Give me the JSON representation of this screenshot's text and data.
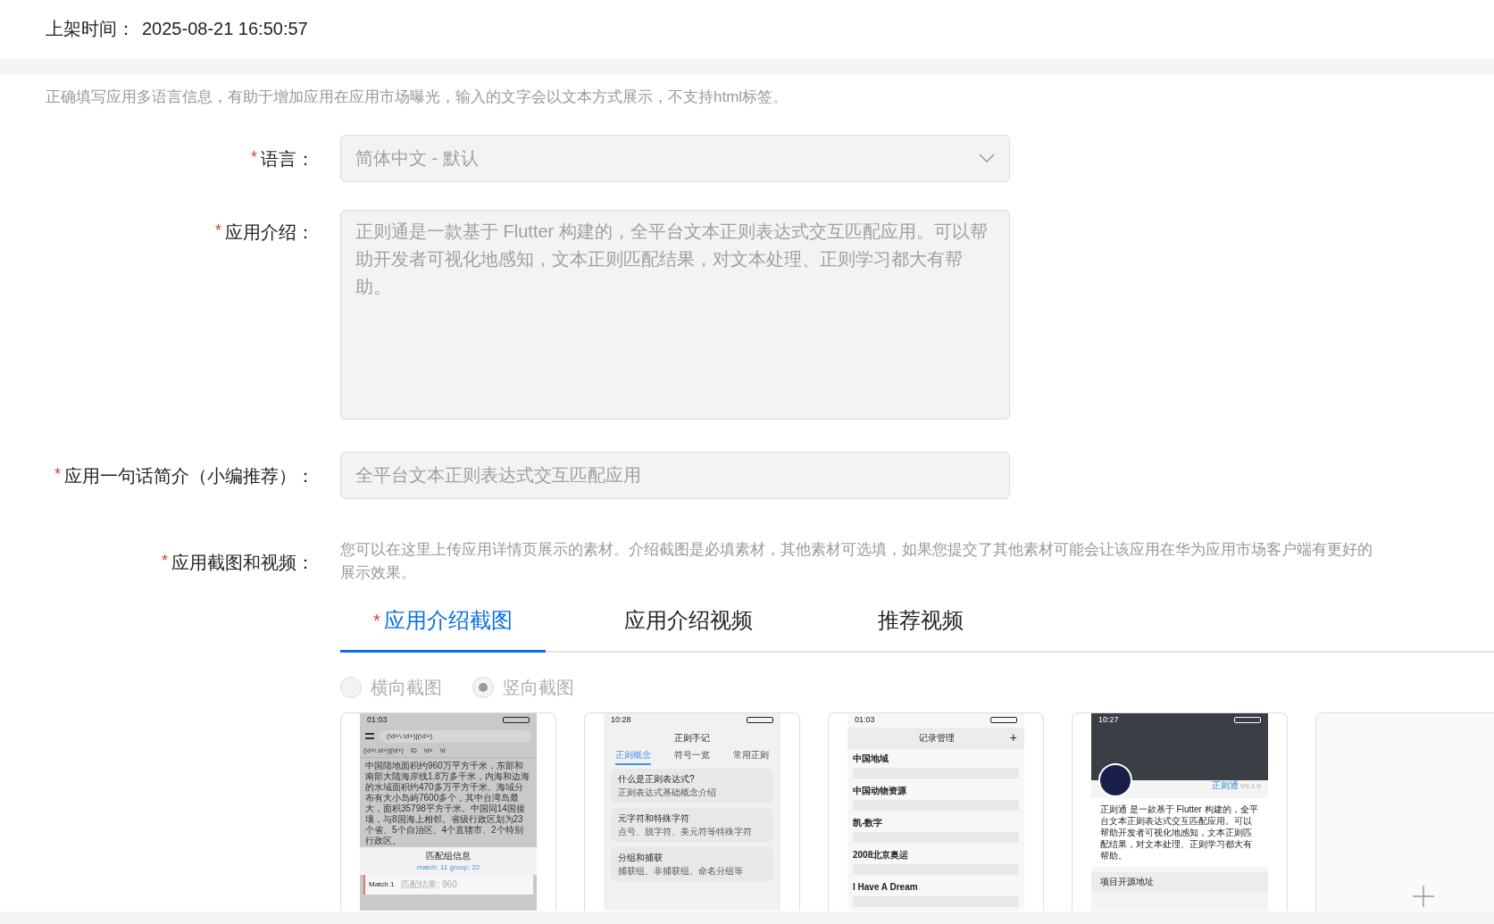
{
  "listing_time": {
    "label": "上架时间：",
    "value": "2025-08-21 16:50:57"
  },
  "section_note": "正确填写应用多语言信息，有助于增加应用在应用市场曝光，输入的文字会以文本方式展示，不支持html标签。",
  "fields": [
    {
      "kind": "select",
      "required_mark": "*",
      "label": "语言：",
      "value": "简体中文 - 默认",
      "disabled": true
    },
    {
      "kind": "textarea",
      "required_mark": "*",
      "label": "应用介绍：",
      "value": "正则通是一款基于 Flutter 构建的，全平台文本正则表达式交互匹配应用。可以帮助开发者可视化地感知，文本正则匹配结果，对文本处理、正则学习都大有帮助。",
      "disabled": true
    },
    {
      "kind": "input",
      "required_mark": "*",
      "label": "应用一句话简介（小编推荐）：",
      "value": "全平台文本正则表达式交互匹配应用",
      "disabled": true
    }
  ],
  "media": {
    "required_mark": "*",
    "label": "应用截图和视频：",
    "note": "您可以在这里上传应用详情页展示的素材。介绍截图是必填素材，其他素材可选填，如果您提交了其他素材可能会让该应用在华为应用市场客户端有更好的展示效果。",
    "tabs": [
      {
        "required_mark": "*",
        "label": "应用介绍截图",
        "selected": true
      },
      {
        "label": "应用介绍视频",
        "selected": false
      },
      {
        "label": "推荐视频",
        "selected": false
      }
    ],
    "orientation": [
      {
        "label": "横向截图",
        "selected": false
      },
      {
        "label": "竖向截图",
        "selected": true
      }
    ],
    "screenshots": [
      {
        "kind": "tester",
        "time": "01:03",
        "pattern": "(\\d+\\.\\d+)|(\\d+)",
        "tabs": [
          "(\\d+\\.\\d+)|(\\d+)",
          "\\D",
          "\\d+",
          "\\d"
        ],
        "text": "中国陆地面积约960万平方千米，东部和南部大陆海岸线1.8万多千米，内海和边海的水域面积约470多万平方千米。海域分布有大小岛屿7600多个，其中台湾岛最大，面积35798平方千米。中国同14国接壤，与8国海上相邻。省级行政区划为23个省、5个自治区、4个直辖市、2个特别行政区。",
        "panel_title": "匹配组信息",
        "panel_info": "match: 11 group: 22",
        "match": "Match 1",
        "match_result": "匹配结果: 960"
      },
      {
        "kind": "notes",
        "time": "10:28",
        "title": "正则手记",
        "tabs": [
          {
            "label": "正则概念",
            "selected": true
          },
          {
            "label": "符号一览",
            "selected": false
          },
          {
            "label": "常用正则",
            "selected": false
          }
        ],
        "items": [
          {
            "title": "什么是正则表达式?",
            "subtitle": "正则表达式基础概念介绍"
          },
          {
            "title": "元字符和特殊字符",
            "subtitle": "点号、脱字符、美元符等特殊字符"
          },
          {
            "title": "分组和捕获",
            "subtitle": "捕获组、非捕获组、命名分组等"
          }
        ]
      },
      {
        "kind": "records",
        "time": "01:03",
        "title": "记录管理",
        "add": "+",
        "items": [
          "中国地域",
          "中国动物资源",
          "凯-数字",
          "2008北京奥运",
          "I Have A Dream"
        ]
      },
      {
        "kind": "about",
        "time": "10:27",
        "app_name": "正则通",
        "version": "V0.1.0",
        "text": "正则通 是一款基于 Flutter 构建的，全平台文本正则表达式交互匹配应用。可以帮助开发者可视化地感知，文本正则匹配结果，对文本处理、正则学习都大有帮助。",
        "link": "项目开源地址"
      },
      {
        "kind": "upload"
      }
    ]
  }
}
